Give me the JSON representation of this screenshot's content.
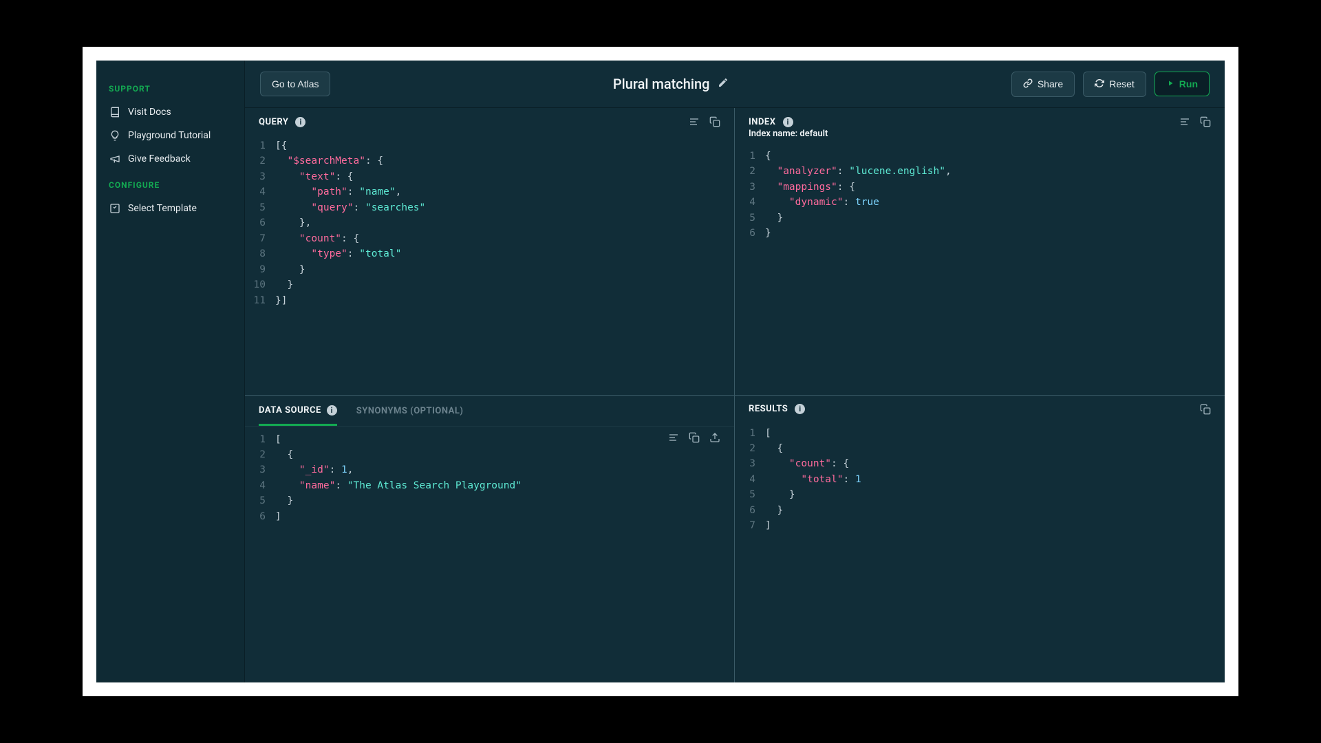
{
  "sidebar": {
    "support_title": "SUPPORT",
    "visit_docs": "Visit Docs",
    "playground_tutorial": "Playground Tutorial",
    "give_feedback": "Give Feedback",
    "configure_title": "CONFIGURE",
    "select_template": "Select Template"
  },
  "topbar": {
    "go_to_atlas": "Go to Atlas",
    "title": "Plural matching",
    "share": "Share",
    "reset": "Reset",
    "run": "Run"
  },
  "query_panel": {
    "title": "QUERY",
    "code": [
      [
        {
          "t": "[{",
          "c": "punc"
        }
      ],
      [
        {
          "t": "  ",
          "c": "punc"
        },
        {
          "t": "\"$searchMeta\"",
          "c": "key"
        },
        {
          "t": ": {",
          "c": "punc"
        }
      ],
      [
        {
          "t": "    ",
          "c": "punc"
        },
        {
          "t": "\"text\"",
          "c": "key"
        },
        {
          "t": ": {",
          "c": "punc"
        }
      ],
      [
        {
          "t": "      ",
          "c": "punc"
        },
        {
          "t": "\"path\"",
          "c": "key"
        },
        {
          "t": ": ",
          "c": "punc"
        },
        {
          "t": "\"name\"",
          "c": "str"
        },
        {
          "t": ",",
          "c": "punc"
        }
      ],
      [
        {
          "t": "      ",
          "c": "punc"
        },
        {
          "t": "\"query\"",
          "c": "key"
        },
        {
          "t": ": ",
          "c": "punc"
        },
        {
          "t": "\"searches\"",
          "c": "str"
        }
      ],
      [
        {
          "t": "    },",
          "c": "punc"
        }
      ],
      [
        {
          "t": "    ",
          "c": "punc"
        },
        {
          "t": "\"count\"",
          "c": "key"
        },
        {
          "t": ": {",
          "c": "punc"
        }
      ],
      [
        {
          "t": "      ",
          "c": "punc"
        },
        {
          "t": "\"type\"",
          "c": "key"
        },
        {
          "t": ": ",
          "c": "punc"
        },
        {
          "t": "\"total\"",
          "c": "str"
        }
      ],
      [
        {
          "t": "    }",
          "c": "punc"
        }
      ],
      [
        {
          "t": "  }",
          "c": "punc"
        }
      ],
      [
        {
          "t": "}]",
          "c": "punc"
        }
      ]
    ]
  },
  "index_panel": {
    "title": "INDEX",
    "subtitle": "Index name: default",
    "code": [
      [
        {
          "t": "{",
          "c": "punc"
        }
      ],
      [
        {
          "t": "  ",
          "c": "punc"
        },
        {
          "t": "\"analyzer\"",
          "c": "key"
        },
        {
          "t": ": ",
          "c": "punc"
        },
        {
          "t": "\"lucene.english\"",
          "c": "str"
        },
        {
          "t": ",",
          "c": "punc"
        }
      ],
      [
        {
          "t": "  ",
          "c": "punc"
        },
        {
          "t": "\"mappings\"",
          "c": "key"
        },
        {
          "t": ": {",
          "c": "punc"
        }
      ],
      [
        {
          "t": "    ",
          "c": "punc"
        },
        {
          "t": "\"dynamic\"",
          "c": "key"
        },
        {
          "t": ": ",
          "c": "punc"
        },
        {
          "t": "true",
          "c": "bool"
        }
      ],
      [
        {
          "t": "  }",
          "c": "punc"
        }
      ],
      [
        {
          "t": "}",
          "c": "punc"
        }
      ]
    ]
  },
  "datasource_panel": {
    "tab_data": "DATA SOURCE",
    "tab_synonyms": "SYNONYMS (OPTIONAL)",
    "code": [
      [
        {
          "t": "[",
          "c": "punc"
        }
      ],
      [
        {
          "t": "  {",
          "c": "punc"
        }
      ],
      [
        {
          "t": "    ",
          "c": "punc"
        },
        {
          "t": "\"_id\"",
          "c": "key"
        },
        {
          "t": ": ",
          "c": "punc"
        },
        {
          "t": "1",
          "c": "num"
        },
        {
          "t": ",",
          "c": "punc"
        }
      ],
      [
        {
          "t": "    ",
          "c": "punc"
        },
        {
          "t": "\"name\"",
          "c": "key"
        },
        {
          "t": ": ",
          "c": "punc"
        },
        {
          "t": "\"The Atlas Search Playground\"",
          "c": "str"
        }
      ],
      [
        {
          "t": "  }",
          "c": "punc"
        }
      ],
      [
        {
          "t": "]",
          "c": "punc"
        }
      ]
    ]
  },
  "results_panel": {
    "title": "RESULTS",
    "code": [
      [
        {
          "t": "[",
          "c": "punc"
        }
      ],
      [
        {
          "t": "  {",
          "c": "punc"
        }
      ],
      [
        {
          "t": "    ",
          "c": "punc"
        },
        {
          "t": "\"count\"",
          "c": "key"
        },
        {
          "t": ": {",
          "c": "punc"
        }
      ],
      [
        {
          "t": "      ",
          "c": "punc"
        },
        {
          "t": "\"total\"",
          "c": "key"
        },
        {
          "t": ": ",
          "c": "punc"
        },
        {
          "t": "1",
          "c": "num"
        }
      ],
      [
        {
          "t": "    }",
          "c": "punc"
        }
      ],
      [
        {
          "t": "  }",
          "c": "punc"
        }
      ],
      [
        {
          "t": "]",
          "c": "punc"
        }
      ]
    ]
  }
}
